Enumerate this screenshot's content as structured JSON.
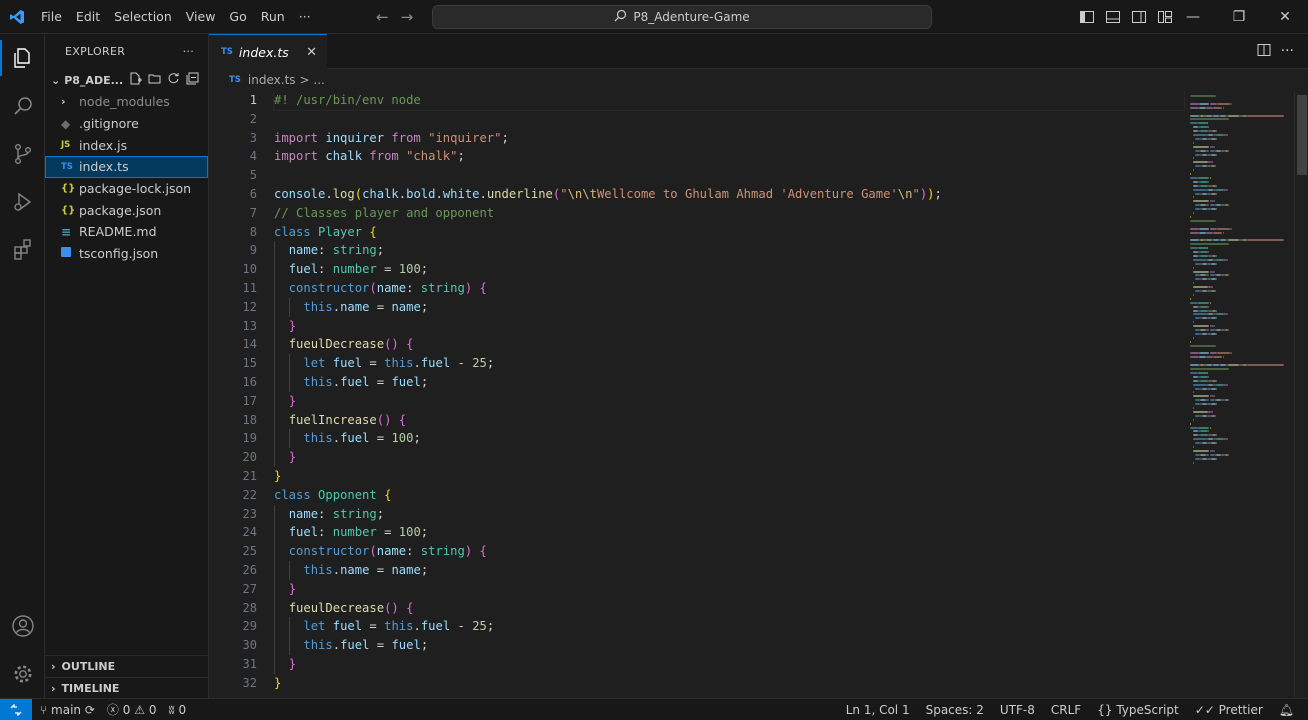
{
  "titlebar": {
    "menu": [
      "File",
      "Edit",
      "Selection",
      "View",
      "Go",
      "Run",
      "···"
    ],
    "search_text": "P8_Adenture-Game"
  },
  "sidebar": {
    "title": "EXPLORER",
    "more": "···",
    "folder_name": "P8_ADE...",
    "files": [
      {
        "icon": "folder",
        "label": "node_modules"
      },
      {
        "icon": "git",
        "label": ".gitignore"
      },
      {
        "icon": "JS",
        "label": "index.js"
      },
      {
        "icon": "TS",
        "label": "index.ts"
      },
      {
        "icon": "{}",
        "label": "package-lock.json"
      },
      {
        "icon": "{}",
        "label": "package.json"
      },
      {
        "icon": "info",
        "label": "README.md"
      },
      {
        "icon": "ts-config",
        "label": "tsconfig.json"
      }
    ],
    "outline": "OUTLINE",
    "timeline": "TIMELINE"
  },
  "tab": {
    "icon": "TS",
    "label": "index.ts",
    "close": "✕"
  },
  "breadcrumb": {
    "icon": "TS",
    "file": "index.ts",
    "rest": "> ..."
  },
  "editor": {
    "line_numbers": [
      "1",
      "2",
      "3",
      "4",
      "5",
      "6",
      "7",
      "8",
      "9",
      "10",
      "11",
      "12",
      "13",
      "14",
      "15",
      "16",
      "17",
      "18",
      "19",
      "20",
      "21",
      "22",
      "23",
      "24",
      "25",
      "26",
      "27",
      "28",
      "29",
      "30",
      "31",
      "32"
    ],
    "lines": [
      [
        [
          "cmt",
          "#! /usr/bin/env node"
        ]
      ],
      [],
      [
        [
          "ctl",
          "import "
        ],
        [
          "var",
          "inquirer"
        ],
        [
          "ctl",
          " from "
        ],
        [
          "str",
          "\"inquirer\""
        ],
        [
          "def",
          ";"
        ]
      ],
      [
        [
          "ctl",
          "import "
        ],
        [
          "var",
          "chalk"
        ],
        [
          "ctl",
          " from "
        ],
        [
          "str",
          "\"chalk\""
        ],
        [
          "def",
          ";"
        ]
      ],
      [],
      [
        [
          "var",
          "console"
        ],
        [
          "def",
          "."
        ],
        [
          "fn",
          "log"
        ],
        [
          "br1",
          "("
        ],
        [
          "var",
          "chalk"
        ],
        [
          "def",
          "."
        ],
        [
          "var",
          "bold"
        ],
        [
          "def",
          "."
        ],
        [
          "var",
          "white"
        ],
        [
          "def",
          "."
        ],
        [
          "fn",
          "underline"
        ],
        [
          "br2",
          "("
        ],
        [
          "str",
          "\""
        ],
        [
          "esc",
          "\\n\\t"
        ],
        [
          "str",
          "Wellcome to Ghulam Ahmad 'Adventure Game'"
        ],
        [
          "esc",
          "\\n"
        ],
        [
          "str",
          "\""
        ],
        [
          "br2",
          ")"
        ],
        [
          "br1",
          ")"
        ],
        [
          "def",
          ";"
        ]
      ],
      [
        [
          "cmt",
          "// Classes player and opponent"
        ]
      ],
      [
        [
          "kw",
          "class "
        ],
        [
          "cls",
          "Player "
        ],
        [
          "br1",
          "{"
        ]
      ],
      [
        [
          "ind",
          "  "
        ],
        [
          "var",
          "name"
        ],
        [
          "def",
          ": "
        ],
        [
          "cls",
          "string"
        ],
        [
          "def",
          ";"
        ]
      ],
      [
        [
          "ind",
          "  "
        ],
        [
          "var",
          "fuel"
        ],
        [
          "def",
          ": "
        ],
        [
          "cls",
          "number"
        ],
        [
          "def",
          " = "
        ],
        [
          "num",
          "100"
        ],
        [
          "def",
          ";"
        ]
      ],
      [
        [
          "ind",
          "  "
        ],
        [
          "kw",
          "constructor"
        ],
        [
          "br2",
          "("
        ],
        [
          "var",
          "name"
        ],
        [
          "def",
          ": "
        ],
        [
          "cls",
          "string"
        ],
        [
          "br2",
          ")"
        ],
        [
          "def",
          " "
        ],
        [
          "br2",
          "{"
        ]
      ],
      [
        [
          "ind",
          "  "
        ],
        [
          "ind2",
          "  "
        ],
        [
          "kw",
          "this"
        ],
        [
          "def",
          "."
        ],
        [
          "var",
          "name"
        ],
        [
          "def",
          " = "
        ],
        [
          "var",
          "name"
        ],
        [
          "def",
          ";"
        ]
      ],
      [
        [
          "ind",
          "  "
        ],
        [
          "br2",
          "}"
        ]
      ],
      [
        [
          "ind",
          "  "
        ],
        [
          "fn",
          "fueulDecrease"
        ],
        [
          "br2",
          "()"
        ],
        [
          "def",
          " "
        ],
        [
          "br2",
          "{"
        ]
      ],
      [
        [
          "ind",
          "  "
        ],
        [
          "ind2",
          "  "
        ],
        [
          "kw",
          "let "
        ],
        [
          "var",
          "fuel"
        ],
        [
          "def",
          " = "
        ],
        [
          "kw",
          "this"
        ],
        [
          "def",
          "."
        ],
        [
          "var",
          "fuel"
        ],
        [
          "def",
          " - "
        ],
        [
          "num",
          "25"
        ],
        [
          "def",
          ";"
        ]
      ],
      [
        [
          "ind",
          "  "
        ],
        [
          "ind2",
          "  "
        ],
        [
          "kw",
          "this"
        ],
        [
          "def",
          "."
        ],
        [
          "var",
          "fuel"
        ],
        [
          "def",
          " = "
        ],
        [
          "var",
          "fuel"
        ],
        [
          "def",
          ";"
        ]
      ],
      [
        [
          "ind",
          "  "
        ],
        [
          "br2",
          "}"
        ]
      ],
      [
        [
          "ind",
          "  "
        ],
        [
          "fn",
          "fuelIncrease"
        ],
        [
          "br2",
          "()"
        ],
        [
          "def",
          " "
        ],
        [
          "br2",
          "{"
        ]
      ],
      [
        [
          "ind",
          "  "
        ],
        [
          "ind2",
          "  "
        ],
        [
          "kw",
          "this"
        ],
        [
          "def",
          "."
        ],
        [
          "var",
          "fuel"
        ],
        [
          "def",
          " = "
        ],
        [
          "num",
          "100"
        ],
        [
          "def",
          ";"
        ]
      ],
      [
        [
          "ind",
          "  "
        ],
        [
          "br2",
          "}"
        ]
      ],
      [
        [
          "br1",
          "}"
        ]
      ],
      [
        [
          "kw",
          "class "
        ],
        [
          "cls",
          "Opponent "
        ],
        [
          "br1",
          "{"
        ]
      ],
      [
        [
          "ind",
          "  "
        ],
        [
          "var",
          "name"
        ],
        [
          "def",
          ": "
        ],
        [
          "cls",
          "string"
        ],
        [
          "def",
          ";"
        ]
      ],
      [
        [
          "ind",
          "  "
        ],
        [
          "var",
          "fuel"
        ],
        [
          "def",
          ": "
        ],
        [
          "cls",
          "number"
        ],
        [
          "def",
          " = "
        ],
        [
          "num",
          "100"
        ],
        [
          "def",
          ";"
        ]
      ],
      [
        [
          "ind",
          "  "
        ],
        [
          "kw",
          "constructor"
        ],
        [
          "br2",
          "("
        ],
        [
          "var",
          "name"
        ],
        [
          "def",
          ": "
        ],
        [
          "cls",
          "string"
        ],
        [
          "br2",
          ")"
        ],
        [
          "def",
          " "
        ],
        [
          "br2",
          "{"
        ]
      ],
      [
        [
          "ind",
          "  "
        ],
        [
          "ind2",
          "  "
        ],
        [
          "kw",
          "this"
        ],
        [
          "def",
          "."
        ],
        [
          "var",
          "name"
        ],
        [
          "def",
          " = "
        ],
        [
          "var",
          "name"
        ],
        [
          "def",
          ";"
        ]
      ],
      [
        [
          "ind",
          "  "
        ],
        [
          "br2",
          "}"
        ]
      ],
      [
        [
          "ind",
          "  "
        ],
        [
          "fn",
          "fueulDecrease"
        ],
        [
          "br2",
          "()"
        ],
        [
          "def",
          " "
        ],
        [
          "br2",
          "{"
        ]
      ],
      [
        [
          "ind",
          "  "
        ],
        [
          "ind2",
          "  "
        ],
        [
          "kw",
          "let "
        ],
        [
          "var",
          "fuel"
        ],
        [
          "def",
          " = "
        ],
        [
          "kw",
          "this"
        ],
        [
          "def",
          "."
        ],
        [
          "var",
          "fuel"
        ],
        [
          "def",
          " - "
        ],
        [
          "num",
          "25"
        ],
        [
          "def",
          ";"
        ]
      ],
      [
        [
          "ind",
          "  "
        ],
        [
          "ind2",
          "  "
        ],
        [
          "kw",
          "this"
        ],
        [
          "def",
          "."
        ],
        [
          "var",
          "fuel"
        ],
        [
          "def",
          " = "
        ],
        [
          "var",
          "fuel"
        ],
        [
          "def",
          ";"
        ]
      ],
      [
        [
          "ind",
          "  "
        ],
        [
          "br2",
          "}"
        ]
      ],
      [
        [
          "br1",
          "}"
        ]
      ]
    ]
  },
  "colors": {
    "accent": "#0078d4",
    "keyword": "#569cd6",
    "control": "#c586c0",
    "string": "#ce9178",
    "function": "#dcdcaa",
    "variable": "#9cdcfe",
    "type": "#4ec9b0",
    "number": "#b5cea8",
    "comment": "#6a9955"
  },
  "statusbar": {
    "branch": "main",
    "errors": "0",
    "warnings": "0",
    "ports": "0",
    "position": "Ln 1, Col 1",
    "spaces": "Spaces: 2",
    "encoding": "UTF-8",
    "eol": "CRLF",
    "language": "TypeScript",
    "formatter": "Prettier"
  }
}
